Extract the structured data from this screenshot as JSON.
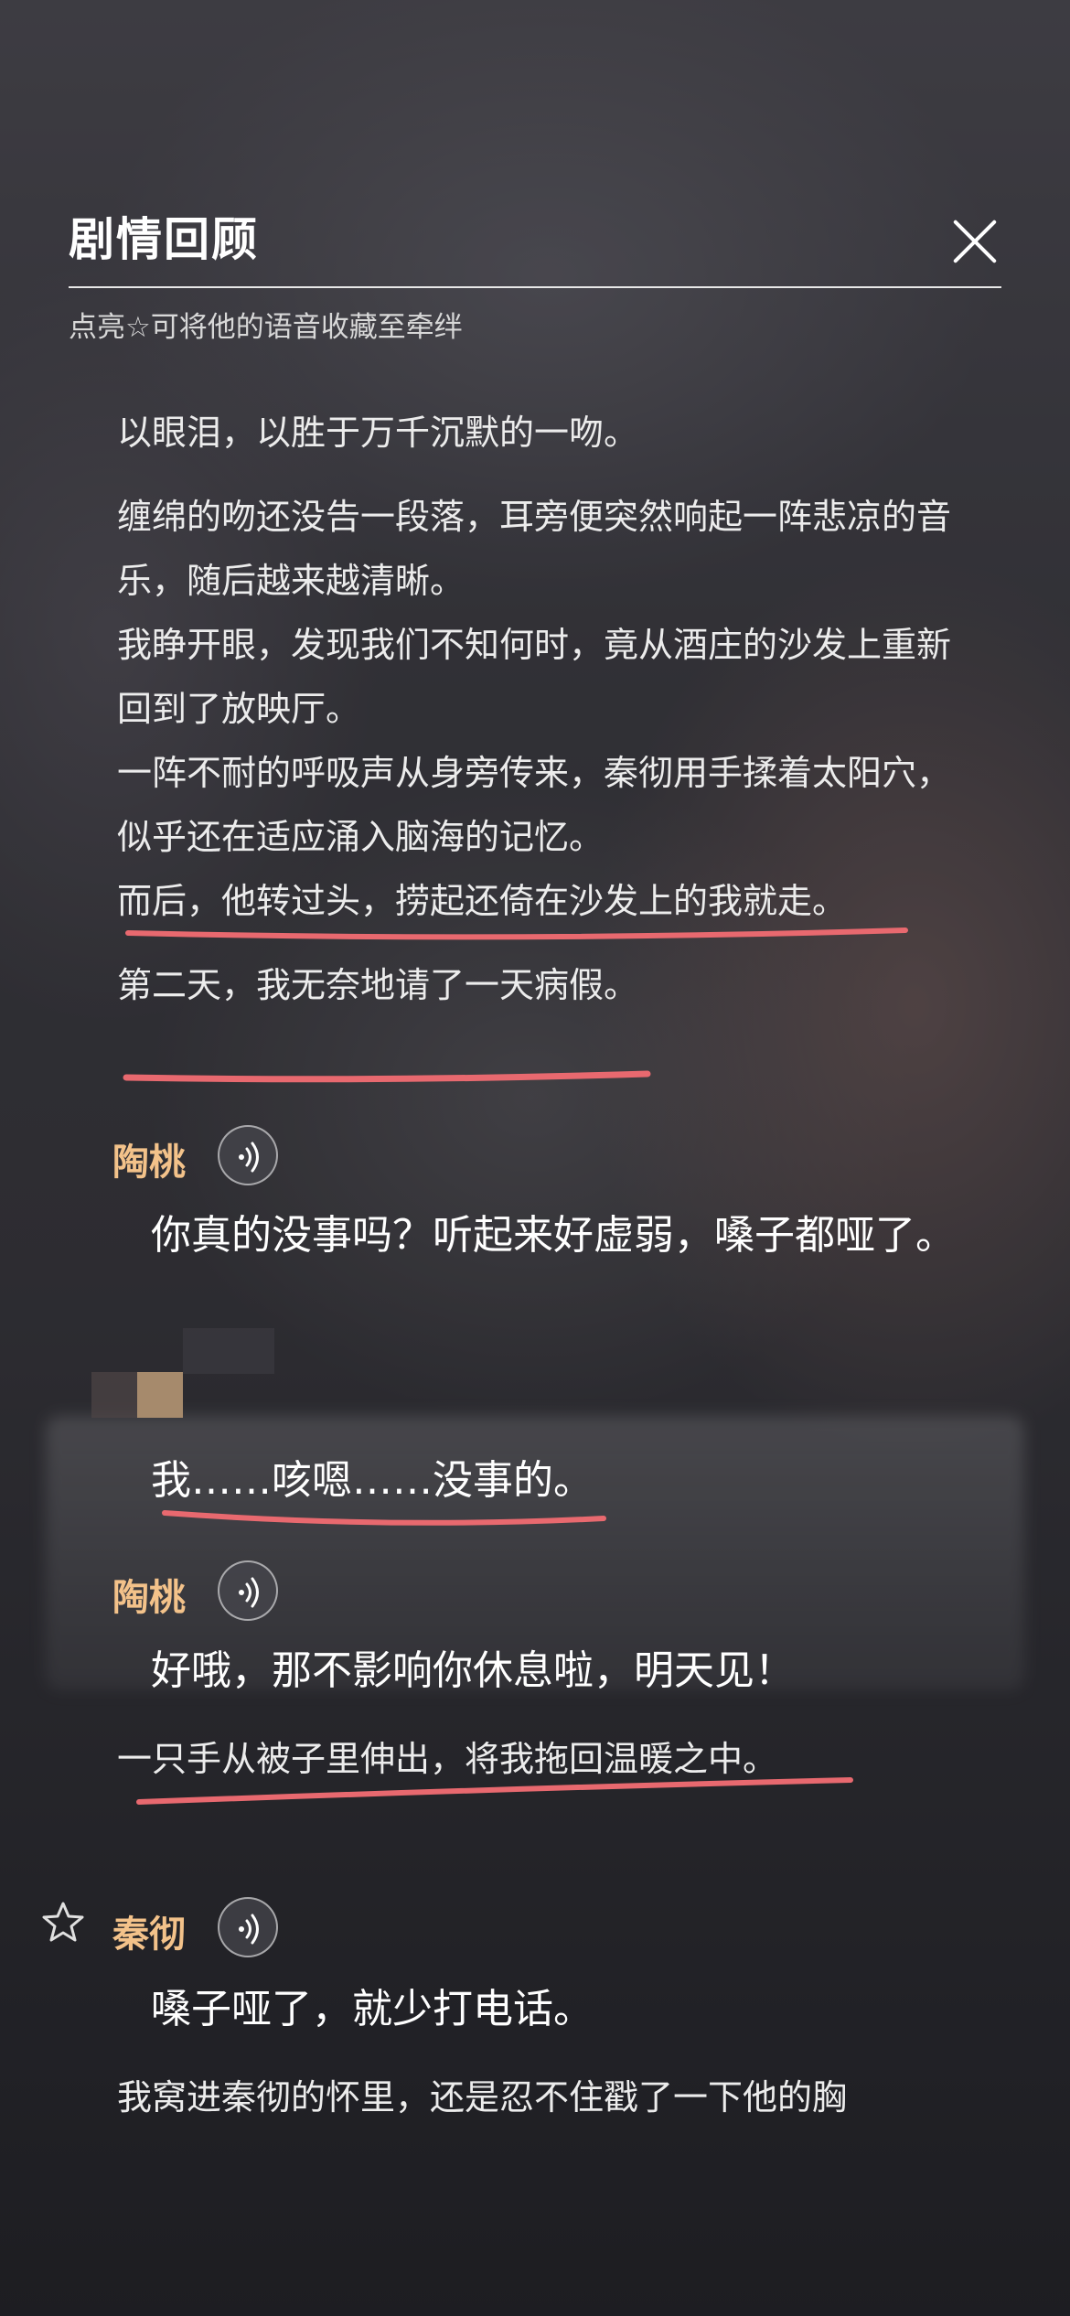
{
  "header": {
    "title": "剧情回顾",
    "hint": "点亮☆可将他的语音收藏至牵绊"
  },
  "icons": {
    "close": "close-icon",
    "voice": "voice-wave-icon",
    "star": "star-outline-icon"
  },
  "colors": {
    "speaker_name": "#f3c28a",
    "underline": "#e8696f"
  },
  "story": {
    "narr1": "以眼泪，以胜于万千沉默的一吻。",
    "narr2": "缠绵的吻还没告一段落，耳旁便突然响起一阵悲凉的音乐，随后越来越清晰。",
    "narr3": "我睁开眼，发现我们不知何时，竟从酒庄的沙发上重新回到了放映厅。",
    "narr4": "一阵不耐的呼吸声从身旁传来，秦彻用手揉着太阳穴，似乎还在适应涌入脑海的记忆。",
    "narr5": "而后，他转过头，捞起还倚在沙发上的我就走。",
    "narr6": "第二天，我无奈地请了一天病假。",
    "speaker1": "陶桃",
    "dialog1": "你真的没事吗？听起来好虚弱，嗓子都哑了。",
    "player1": "我……咳嗯……没事的。",
    "speaker2": "陶桃",
    "dialog2": "好哦，那不影响你休息啦，明天见！",
    "narr7": "一只手从被子里伸出，将我拖回温暖之中。",
    "speaker3": "秦彻",
    "dialog3": "嗓子哑了，就少打电话。",
    "narr8": "我窝进秦彻的怀里，还是忍不住戳了一下他的胸"
  }
}
